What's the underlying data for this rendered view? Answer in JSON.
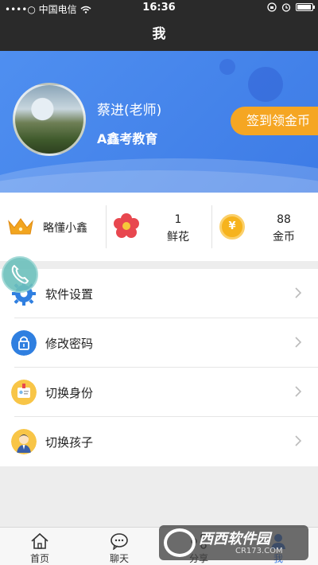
{
  "status_bar": {
    "carrier": "••••○ 中国电信",
    "time": "16:36"
  },
  "nav": {
    "title": "我"
  },
  "profile": {
    "name": "蔡进(老师)",
    "organization": "A鑫考教育",
    "checkin_label": "签到领金币"
  },
  "stats": {
    "level_label": "略懂小鑫",
    "flowers_count": "1",
    "flowers_label": "鲜花",
    "coins_count": "88",
    "coins_label": "金币",
    "coin_symbol": "¥"
  },
  "menu": [
    {
      "label": "软件设置",
      "icon": "gear-icon"
    },
    {
      "label": "修改密码",
      "icon": "lock-icon"
    },
    {
      "label": "切换身份",
      "icon": "id-card-icon"
    },
    {
      "label": "切换孩子",
      "icon": "child-avatar-icon"
    }
  ],
  "tabbar": [
    {
      "label": "首页",
      "icon": "home-icon"
    },
    {
      "label": "聊天",
      "icon": "chat-icon"
    },
    {
      "label": "分享",
      "icon": "share-icon"
    },
    {
      "label": "我",
      "icon": "me-icon",
      "active": true
    }
  ],
  "watermark": {
    "main": "西西软件园",
    "sub": "CR173.COM"
  },
  "colors": {
    "accent": "#3d7be6",
    "checkin": "#f5a623",
    "topbar": "#2a2a2a"
  }
}
